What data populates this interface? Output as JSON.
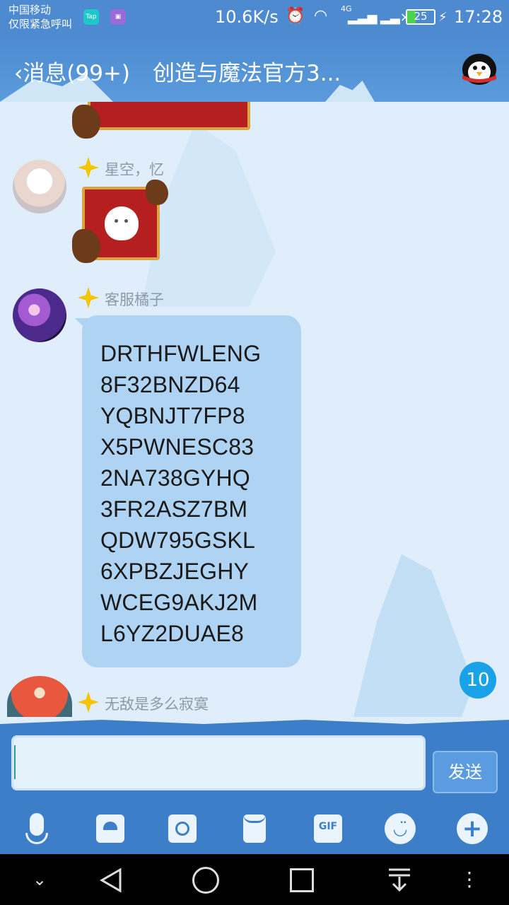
{
  "status_bar": {
    "carrier": "中国移动",
    "emergency": "仅限紧急呼叫",
    "app_icons": [
      "TapTap",
      "gallery"
    ],
    "net_speed": "10.6K/s",
    "network": "4G",
    "battery": "25",
    "time": "17:28"
  },
  "header": {
    "back_label": "‹消息(99+)",
    "title": "创造与魔法官方3..."
  },
  "messages": [
    {
      "nickname": "星空，忆",
      "type": "sticker"
    },
    {
      "nickname": "客服橘子",
      "type": "text",
      "lines": [
        "DRTHFWLENG",
        "8F32BNZD64",
        "YQBNJT7FP8",
        "X5PWNESC83",
        "2NA738GYHQ",
        "3FR2ASZ7BM",
        "QDW795GSKL",
        "6XPBZJEGHY",
        "WCEG9AKJ2M",
        "L6YZ2DUAE8"
      ]
    },
    {
      "nickname": "无敌是多么寂寞",
      "type": "partial"
    }
  ],
  "unread_count": "10",
  "input": {
    "value": "",
    "send_label": "发送"
  },
  "toolbar": {
    "items": [
      "mic-icon",
      "image-icon",
      "camera-icon",
      "red-packet-icon",
      "gif-icon",
      "emoji-icon",
      "plus-icon"
    ],
    "gif_label": "GIF"
  },
  "nav_bar": {
    "items": [
      "collapse-icon",
      "back-icon",
      "home-icon",
      "recents-icon",
      "pull-down-icon",
      "more-icon"
    ]
  }
}
